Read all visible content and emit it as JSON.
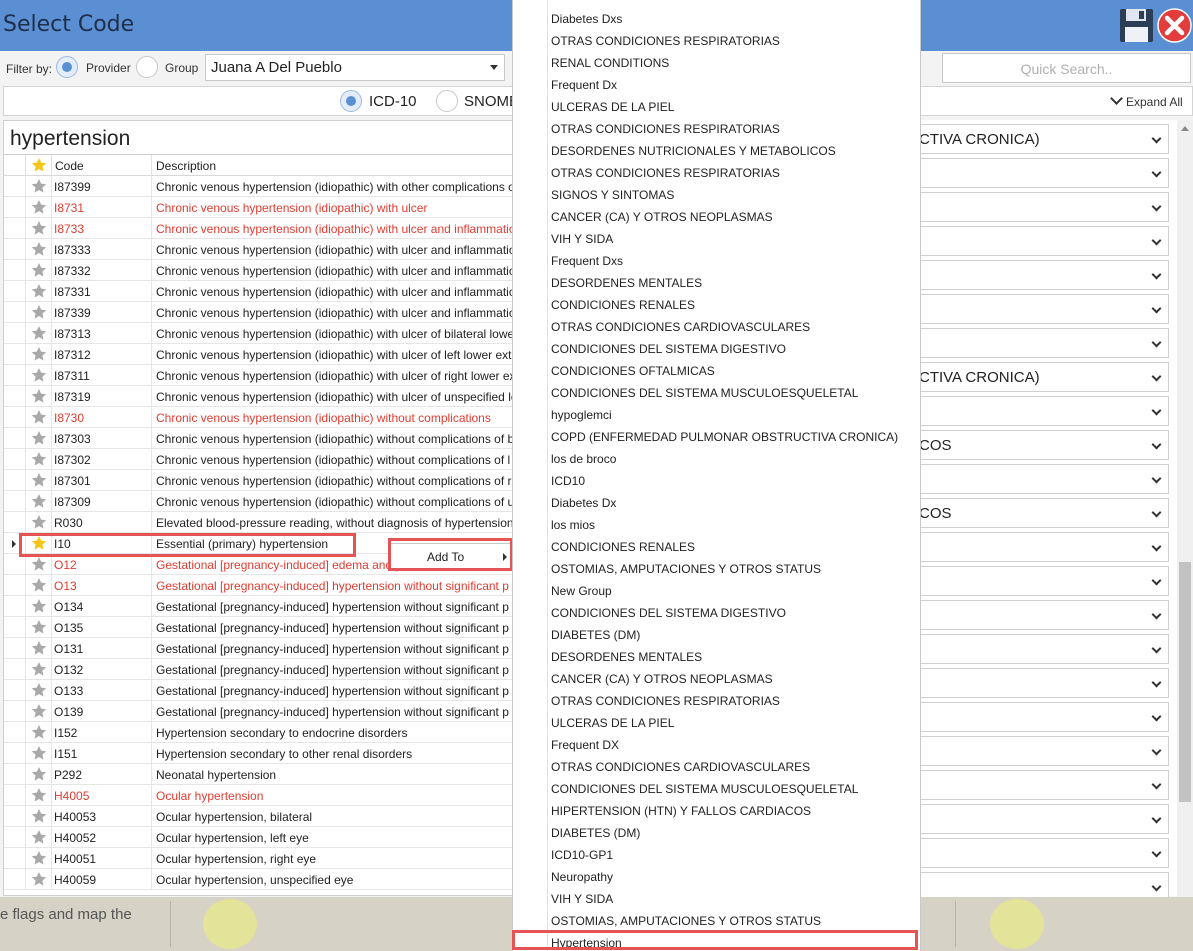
{
  "window": {
    "title": "Select Code"
  },
  "filter": {
    "label": "Filter by:",
    "provider_label": "Provider",
    "group_label": "Group",
    "provider_value": "Juana A Del Pueblo",
    "quick_search_placeholder": "Quick Search.."
  },
  "code_types": {
    "icd10": "ICD-10",
    "snomed": "SNOME",
    "expand_all": "Expand All"
  },
  "search": {
    "term": "hypertension"
  },
  "grid": {
    "headers": {
      "code": "Code",
      "description": "Description"
    },
    "rows": [
      {
        "code": "I87399",
        "desc": "Chronic venous hypertension (idiopathic) with other complications of",
        "red": false,
        "fav": false
      },
      {
        "code": "I8731",
        "desc": "Chronic venous hypertension (idiopathic) with ulcer",
        "red": true,
        "fav": false
      },
      {
        "code": "I8733",
        "desc": "Chronic venous hypertension (idiopathic) with ulcer and inflammation",
        "red": true,
        "fav": false
      },
      {
        "code": "I87333",
        "desc": "Chronic venous hypertension (idiopathic) with ulcer and inflammation",
        "red": false,
        "fav": false
      },
      {
        "code": "I87332",
        "desc": "Chronic venous hypertension (idiopathic) with ulcer and inflammation",
        "red": false,
        "fav": false
      },
      {
        "code": "I87331",
        "desc": "Chronic venous hypertension (idiopathic) with ulcer and inflammation",
        "red": false,
        "fav": false
      },
      {
        "code": "I87339",
        "desc": "Chronic venous hypertension (idiopathic) with ulcer and inflammation",
        "red": false,
        "fav": false
      },
      {
        "code": "I87313",
        "desc": "Chronic venous hypertension (idiopathic) with ulcer of bilateral lower",
        "red": false,
        "fav": false
      },
      {
        "code": "I87312",
        "desc": "Chronic venous hypertension (idiopathic) with ulcer of left lower ext",
        "red": false,
        "fav": false
      },
      {
        "code": "I87311",
        "desc": "Chronic venous hypertension (idiopathic) with ulcer of right lower ex",
        "red": false,
        "fav": false
      },
      {
        "code": "I87319",
        "desc": "Chronic venous hypertension (idiopathic) with ulcer of unspecified lo",
        "red": false,
        "fav": false
      },
      {
        "code": "I8730",
        "desc": "Chronic venous hypertension (idiopathic) without complications",
        "red": true,
        "fav": false
      },
      {
        "code": "I87303",
        "desc": "Chronic venous hypertension (idiopathic) without complications of b",
        "red": false,
        "fav": false
      },
      {
        "code": "I87302",
        "desc": "Chronic venous hypertension (idiopathic) without complications of l",
        "red": false,
        "fav": false
      },
      {
        "code": "I87301",
        "desc": "Chronic venous hypertension (idiopathic) without complications of r",
        "red": false,
        "fav": false
      },
      {
        "code": "I87309",
        "desc": "Chronic venous hypertension (idiopathic) without complications of u",
        "red": false,
        "fav": false
      },
      {
        "code": "R030",
        "desc": "Elevated blood-pressure reading, without diagnosis of hypertension",
        "red": false,
        "fav": false
      },
      {
        "code": "I10",
        "desc": "Essential (primary) hypertension",
        "red": false,
        "fav": true,
        "selected": true
      },
      {
        "code": "O12",
        "desc": "Gestational [pregnancy-induced] edema and p",
        "red": true,
        "fav": false
      },
      {
        "code": "O13",
        "desc": "Gestational [pregnancy-induced] hypertension without significant p",
        "red": true,
        "fav": false
      },
      {
        "code": "O134",
        "desc": "Gestational [pregnancy-induced] hypertension without significant p",
        "red": false,
        "fav": false
      },
      {
        "code": "O135",
        "desc": "Gestational [pregnancy-induced] hypertension without significant p",
        "red": false,
        "fav": false
      },
      {
        "code": "O131",
        "desc": "Gestational [pregnancy-induced] hypertension without significant p",
        "red": false,
        "fav": false
      },
      {
        "code": "O132",
        "desc": "Gestational [pregnancy-induced] hypertension without significant p",
        "red": false,
        "fav": false
      },
      {
        "code": "O133",
        "desc": "Gestational [pregnancy-induced] hypertension without significant p",
        "red": false,
        "fav": false
      },
      {
        "code": "O139",
        "desc": "Gestational [pregnancy-induced] hypertension without significant p",
        "red": false,
        "fav": false
      },
      {
        "code": "I152",
        "desc": "Hypertension secondary to endocrine disorders",
        "red": false,
        "fav": false
      },
      {
        "code": "I151",
        "desc": "Hypertension secondary to other renal disorders",
        "red": false,
        "fav": false
      },
      {
        "code": "P292",
        "desc": "Neonatal hypertension",
        "red": false,
        "fav": false
      },
      {
        "code": "H4005",
        "desc": "Ocular hypertension",
        "red": true,
        "fav": false
      },
      {
        "code": "H40053",
        "desc": "Ocular hypertension, bilateral",
        "red": false,
        "fav": false
      },
      {
        "code": "H40052",
        "desc": "Ocular hypertension, left eye",
        "red": false,
        "fav": false
      },
      {
        "code": "H40051",
        "desc": "Ocular hypertension, right eye",
        "red": false,
        "fav": false
      },
      {
        "code": "H40059",
        "desc": "Ocular hypertension, unspecified eye",
        "red": false,
        "fav": false
      }
    ]
  },
  "context_menu": {
    "add_to": "Add To"
  },
  "groups": [
    "Diabetes Dxs",
    "OTRAS CONDICIONES RESPIRATORIAS",
    "RENAL CONDITIONS",
    "Frequent Dx",
    "ULCERAS DE LA PIEL",
    "OTRAS CONDICIONES RESPIRATORIAS",
    "DESORDENES NUTRICIONALES Y METABOLICOS",
    "OTRAS CONDICIONES RESPIRATORIAS",
    "SIGNOS Y SINTOMAS",
    "CANCER (CA) Y OTROS NEOPLASMAS",
    "VIH Y SIDA",
    "Frequent Dxs",
    "DESORDENES MENTALES",
    "CONDICIONES RENALES",
    "OTRAS CONDICIONES CARDIOVASCULARES",
    "CONDICIONES DEL SISTEMA DIGESTIVO",
    "CONDICIONES OFTALMICAS",
    "CONDICIONES DEL SISTEMA MUSCULOESQUELETAL",
    "hypoglemci",
    "COPD (ENFERMEDAD PULMONAR OBSTRUCTIVA CRONICA)",
    "los de broco",
    "ICD10",
    "Diabetes Dx",
    "los mios",
    "CONDICIONES RENALES",
    "OSTOMIAS, AMPUTACIONES Y OTROS STATUS",
    "New Group",
    "CONDICIONES DEL SISTEMA DIGESTIVO",
    "DIABETES (DM)",
    "DESORDENES MENTALES",
    "CANCER (CA) Y OTROS NEOPLASMAS",
    "OTRAS CONDICIONES RESPIRATORIAS",
    "ULCERAS DE LA PIEL",
    "Frequent DX",
    "OTRAS CONDICIONES CARDIOVASCULARES",
    "CONDICIONES DEL SISTEMA MUSCULOESQUELETAL",
    "HIPERTENSION (HTN) Y FALLOS CARDIACOS",
    "DIABETES (DM)",
    "ICD10-GP1",
    "Neuropathy",
    "VIH Y SIDA",
    "OSTOMIAS, AMPUTACIONES Y OTROS STATUS",
    "Hypertension"
  ],
  "right_panel": {
    "rows": [
      "CTIVA CRONICA)",
      "",
      "",
      "",
      "",
      "",
      "",
      "CTIVA CRONICA)",
      "",
      "COS",
      "",
      "COS",
      "",
      "",
      "",
      "",
      "",
      "",
      "",
      "",
      "",
      "",
      "",
      ""
    ]
  },
  "footer": {
    "text": "e flags and map the"
  },
  "colors": {
    "title_bar": "#5b8fd3",
    "highlight_red": "#e45454",
    "code_red": "#e03c31",
    "star_gold": "#f5c518"
  }
}
